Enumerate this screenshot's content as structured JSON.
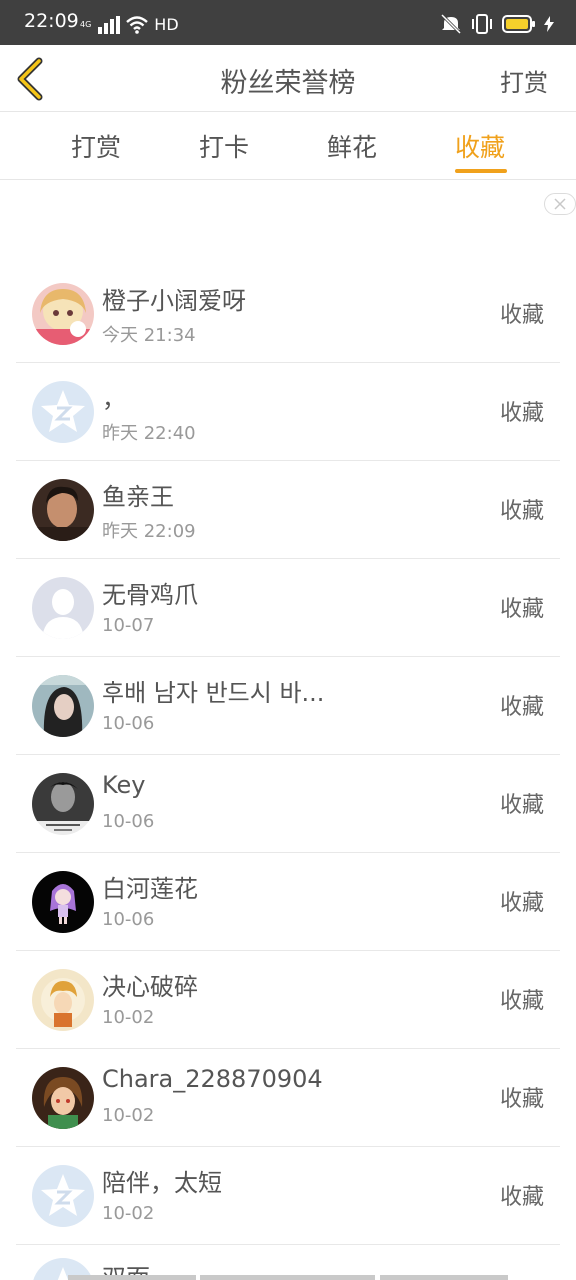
{
  "status": {
    "time": "22:09",
    "network": "4G",
    "hd": "HD"
  },
  "header": {
    "title": "粉丝荣誉榜",
    "right_label": "打赏"
  },
  "tabs": [
    {
      "label": "打赏"
    },
    {
      "label": "打卡"
    },
    {
      "label": "鲜花"
    },
    {
      "label": "收藏"
    }
  ],
  "colors": {
    "accent": "#f0a11c",
    "status_bar": "#404040"
  },
  "list": [
    {
      "name": "橙子小阔爱呀",
      "time": "今天 21:34",
      "action": "收藏",
      "avatar": "anime-girl-avatar"
    },
    {
      "name": "，",
      "time": "昨天 22:40",
      "action": "收藏",
      "avatar": "default-star-avatar"
    },
    {
      "name": "鱼亲王",
      "time": "昨天 22:09",
      "action": "收藏",
      "avatar": "photo-avatar"
    },
    {
      "name": "无骨鸡爪",
      "time": "10-07",
      "action": "收藏",
      "avatar": "default-person-avatar"
    },
    {
      "name": "후배 남자 반드시 바...",
      "time": "10-06",
      "action": "收藏",
      "avatar": "photo-avatar"
    },
    {
      "name": "Key",
      "time": "10-06",
      "action": "收藏",
      "avatar": "photo-avatar"
    },
    {
      "name": "白河莲花",
      "time": "10-06",
      "action": "收藏",
      "avatar": "anime-avatar"
    },
    {
      "name": "决心破碎",
      "time": "10-02",
      "action": "收藏",
      "avatar": "anime-avatar"
    },
    {
      "name": "Chara_228870904",
      "time": "10-02",
      "action": "收藏",
      "avatar": "anime-avatar"
    },
    {
      "name": "陪伴，太短",
      "time": "10-02",
      "action": "收藏",
      "avatar": "default-star-avatar"
    }
  ],
  "partial_item": {
    "name": "双面"
  }
}
